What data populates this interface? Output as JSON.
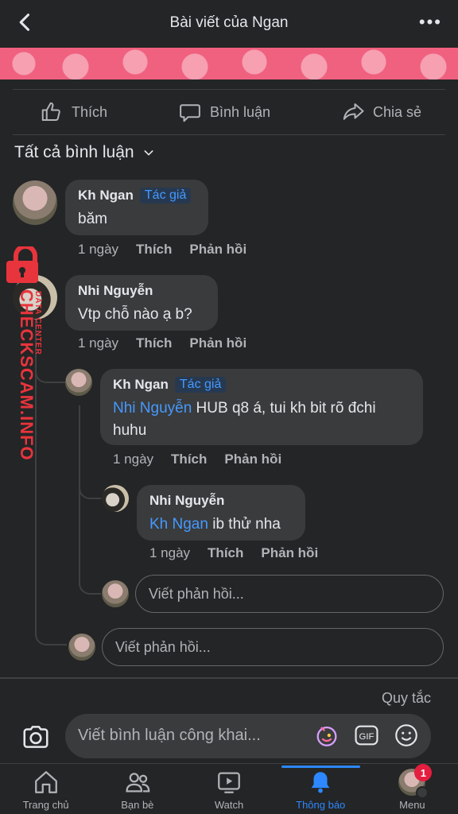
{
  "header": {
    "title": "Bài viết của Ngan"
  },
  "actions": {
    "like": "Thích",
    "comment": "Bình luận",
    "share": "Chia sẻ"
  },
  "filter": {
    "label": "Tất cả bình luận"
  },
  "comments": [
    {
      "author": "Kh Ngan",
      "tag": "Tác giả",
      "text": "băm",
      "time": "1 ngày",
      "like": "Thích",
      "reply": "Phản hồi"
    },
    {
      "author": "Nhi Nguyễn",
      "text": "Vtp chỗ nào ạ b?",
      "time": "1 ngày",
      "like": "Thích",
      "reply": "Phản hồi"
    }
  ],
  "replies": [
    {
      "author": "Kh Ngan",
      "tag": "Tác giả",
      "mention": "Nhi Nguyễn",
      "text": " HUB q8 á, tui kh bit rõ đchi",
      "text2": "huhu",
      "time": "1 ngày",
      "like": "Thích",
      "reply": "Phản hồi"
    },
    {
      "author": "Nhi Nguyễn",
      "mention": "Kh Ngan",
      "text": " ib thử nha",
      "time": "1 ngày",
      "like": "Thích",
      "reply": "Phản hồi"
    }
  ],
  "reply_placeholder": "Viết phản hồi...",
  "rules_link": "Quy tắc",
  "composer": {
    "placeholder": "Viết bình luận công khai...",
    "gif": "GIF"
  },
  "tabs": [
    {
      "label": "Trang chủ"
    },
    {
      "label": "Bạn bè"
    },
    {
      "label": "Watch"
    },
    {
      "label": "Thông báo"
    },
    {
      "label": "Menu",
      "badge": "1"
    }
  ],
  "watermark": {
    "text": "CHECKSCAM.INFO",
    "sub": "DATA CENTER"
  },
  "colors": {
    "accent": "#2d88ff",
    "mention": "#4599ff",
    "badge": "#e41e3f"
  }
}
